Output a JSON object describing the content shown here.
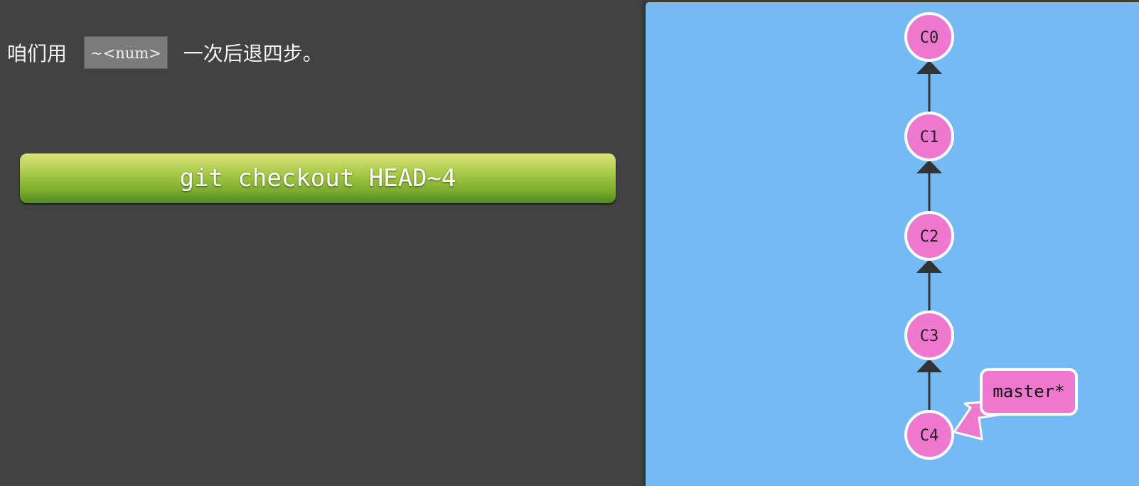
{
  "instruction": {
    "prefix": "咱们用",
    "code": "~<num>",
    "suffix": "一次后退四步。"
  },
  "command": {
    "text": "git checkout HEAD~4"
  },
  "graph": {
    "commits": [
      "C0",
      "C1",
      "C2",
      "C3",
      "C4"
    ],
    "branch": {
      "name": "master*",
      "target": "C4"
    },
    "colors": {
      "background": "#74baf5",
      "commit_fill": "#ef78cf",
      "commit_stroke": "#ffffff",
      "edge": "#333333"
    }
  }
}
